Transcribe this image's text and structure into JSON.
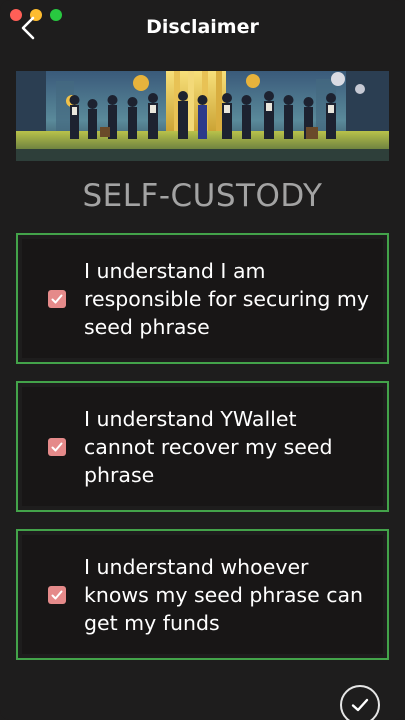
{
  "window": {
    "title": "Disclaimer"
  },
  "heading": "SELF-CUSTODY",
  "colors": {
    "accent_border": "#43a34a",
    "checkbox": "#e58a8a",
    "background": "#1e1d1d"
  },
  "items": [
    {
      "label": "I understand I am responsible for securing my seed phrase",
      "checked": true
    },
    {
      "label": "I understand YWallet cannot recover my seed phrase",
      "checked": true
    },
    {
      "label": "I understand whoever knows my seed phrase can get my funds",
      "checked": true
    }
  ],
  "icons": {
    "back": "chevron-left-icon",
    "confirm": "checkmark-icon",
    "checkbox": "checkbox-checked-icon"
  }
}
